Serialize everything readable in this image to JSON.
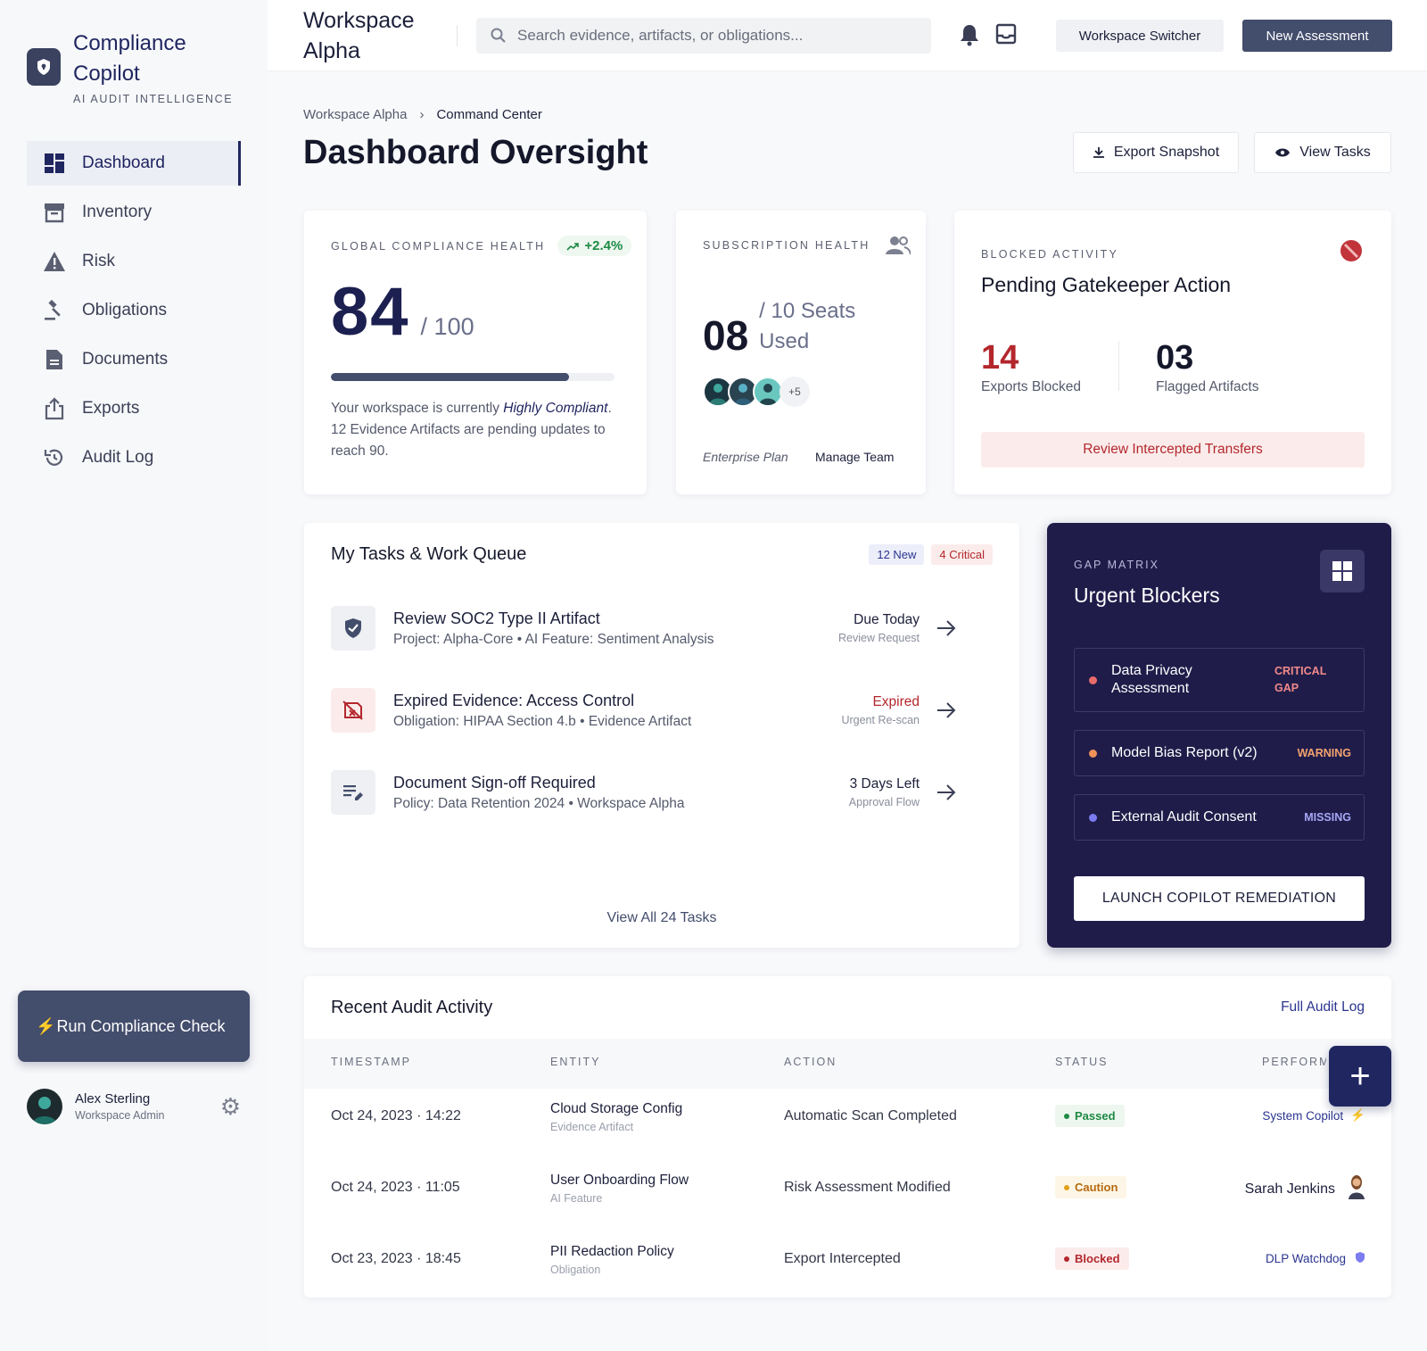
{
  "brand": {
    "title": "Compliance Copilot",
    "subtitle": "AI AUDIT INTELLIGENCE"
  },
  "sidebar": {
    "items": [
      {
        "label": "Dashboard",
        "icon": "dashboard-icon",
        "active": true
      },
      {
        "label": "Inventory",
        "icon": "inventory-icon"
      },
      {
        "label": "Risk",
        "icon": "warning-icon"
      },
      {
        "label": "Obligations",
        "icon": "gavel-icon"
      },
      {
        "label": "Documents",
        "icon": "document-icon"
      },
      {
        "label": "Exports",
        "icon": "export-icon"
      },
      {
        "label": "Audit Log",
        "icon": "history-icon"
      }
    ],
    "run_check": "Run Compliance Check",
    "user": {
      "name": "Alex Sterling",
      "role": "Workspace Admin"
    }
  },
  "topbar": {
    "workspace": "Workspace Alpha",
    "search_placeholder": "Search evidence, artifacts, or obligations...",
    "switcher": "Workspace Switcher",
    "new_assessment": "New Assessment"
  },
  "breadcrumb": {
    "root": "Workspace Alpha",
    "sep": "›",
    "current": "Command Center"
  },
  "page": {
    "title": "Dashboard Oversight",
    "export_label": "Export Snapshot",
    "tasks_label": "View Tasks"
  },
  "health": {
    "eyebrow": "GLOBAL COMPLIANCE HEALTH",
    "trend": "+2.4%",
    "score": "84",
    "out_of": "/ 100",
    "progress": 0.84,
    "desc_pre": "Your workspace is currently ",
    "desc_em": "Highly Compliant",
    "desc_post": ". 12 Evidence Artifacts are pending updates to reach 90."
  },
  "subscription": {
    "eyebrow": "SUBSCRIPTION HEALTH",
    "used": "08",
    "seats": "/ 10 Seats",
    "used_label": "Used",
    "more": "+5",
    "plan": "Enterprise Plan",
    "manage": "Manage Team"
  },
  "blocked": {
    "eyebrow": "BLOCKED ACTIVITY",
    "title": "Pending Gatekeeper Action",
    "exports_value": "14",
    "exports_label": "Exports Blocked",
    "flagged_value": "03",
    "flagged_label": "Flagged Artifacts",
    "action": "Review Intercepted Transfers"
  },
  "tasks": {
    "title": "My Tasks & Work Queue",
    "new_tag": "12 New",
    "critical_tag": "4 Critical",
    "items": [
      {
        "title": "Review SOC2 Type II Artifact",
        "sub": "Project: Alpha-Core • AI Feature: Sentiment Analysis",
        "due": "Due Today",
        "due_sub": "Review Request",
        "icon": "shield-check-icon"
      },
      {
        "title": "Expired Evidence: Access Control",
        "sub": "Obligation: HIPAA Section 4.b • Evidence Artifact",
        "due": "Expired",
        "due_sub": "Urgent Re-scan",
        "icon": "expired-file-icon"
      },
      {
        "title": "Document Sign-off Required",
        "sub": "Policy: Data Retention 2024 • Workspace Alpha",
        "due": "3 Days Left",
        "due_sub": "Approval Flow",
        "icon": "edit-note-icon"
      }
    ],
    "view_all": "View All 24 Tasks"
  },
  "gap": {
    "eyebrow": "GAP MATRIX",
    "title": "Urgent Blockers",
    "items": [
      {
        "name": "Data Privacy Assessment",
        "severity": "CRITICAL GAP",
        "color": "#e86b6b"
      },
      {
        "name": "Model Bias Report (v2)",
        "severity": "WARNING",
        "color": "#f0925a"
      },
      {
        "name": "External Audit Consent",
        "severity": "MISSING",
        "color": "#7b7cf0"
      }
    ],
    "launch": "LAUNCH COPILOT REMEDIATION"
  },
  "audit": {
    "title": "Recent Audit Activity",
    "full_log": "Full Audit Log",
    "columns": [
      "TIMESTAMP",
      "ENTITY",
      "ACTION",
      "STATUS",
      "PERFORMED BY"
    ],
    "rows": [
      {
        "timestamp": "Oct 24, 2023 · 14:22",
        "entity": "Cloud Storage Config",
        "entity_sub": "Evidence Artifact",
        "action": "Automatic Scan Completed",
        "status": "Passed",
        "by": "System Copilot"
      },
      {
        "timestamp": "Oct 24, 2023 · 11:05",
        "entity": "User Onboarding Flow",
        "entity_sub": "AI Feature",
        "action": "Risk Assessment Modified",
        "status": "Caution",
        "by": "Sarah Jenkins"
      },
      {
        "timestamp": "Oct 23, 2023 · 18:45",
        "entity": "PII Redaction Policy",
        "entity_sub": "Obligation",
        "action": "Export Intercepted",
        "status": "Blocked",
        "by": "DLP Watchdog"
      }
    ]
  },
  "colors": {
    "primary": "#202660",
    "accent_slate": "#434d6c",
    "danger": "#b3272d",
    "gap_bg": "#201c4a"
  }
}
